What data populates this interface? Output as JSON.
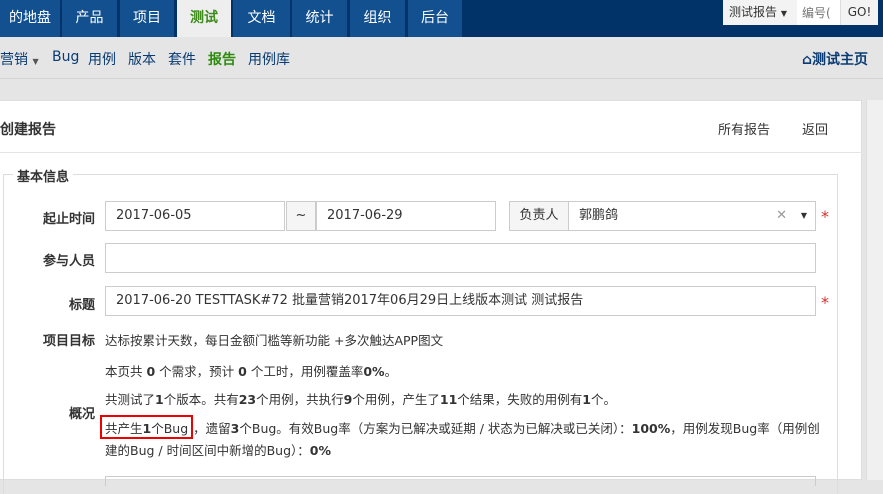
{
  "topnav": {
    "tabs": [
      "的地盘",
      "产品",
      "项目",
      "测试",
      "文档",
      "统计",
      "组织",
      "后台"
    ],
    "active": "测试",
    "search_type": "测试报告",
    "search_placeholder": "编号(",
    "go_label": "GO!"
  },
  "subnav": {
    "product": "营销",
    "items": [
      "Bug",
      "用例",
      "版本",
      "套件",
      "报告",
      "用例库"
    ],
    "active": "报告",
    "home_link": "测试主页"
  },
  "page": {
    "title": "创建报告",
    "all_reports": "所有报告",
    "back": "返回"
  },
  "form": {
    "legend": "基本信息",
    "date_label": "起止时间",
    "begin": "2017-06-05",
    "sep": "~",
    "end": "2017-06-29",
    "owner_addon": "负责人",
    "owner": "郭鹏鸽",
    "members_label": "参与人员",
    "members": "",
    "title_label": "标题",
    "title": "2017-06-20 TESTTASK#72 批量营销2017年06月29日上线版本测试 测试报告",
    "goal_label": "项目目标",
    "goal": "达标按累计天数，每日金额门槛等新功能 +多次触达APP图文",
    "summary_label": "概况",
    "summary": {
      "line1": [
        "本页共 ",
        "0",
        " 个需求，预计 ",
        "0",
        " 个工时，用例覆盖率",
        "0%",
        "。"
      ],
      "line2": [
        "共测试了",
        "1",
        "个版本。共有",
        "23",
        "个用例，共执行",
        "9",
        "个用例，产生了",
        "11",
        "个结果，失败的用例有",
        "1",
        "个。"
      ],
      "bug_highlight": [
        "共产生",
        "1",
        "个Bug"
      ],
      "line3": [
        "，遗留",
        "3",
        "个Bug。有效Bug率（方案为已解决或延期 / 状态为已解决或已关闭）：",
        "100%",
        "，用例发现Bug率（用例创"
      ],
      "line4": [
        "建的Bug / 时间区间中新增的Bug）：",
        "0%"
      ]
    }
  }
}
